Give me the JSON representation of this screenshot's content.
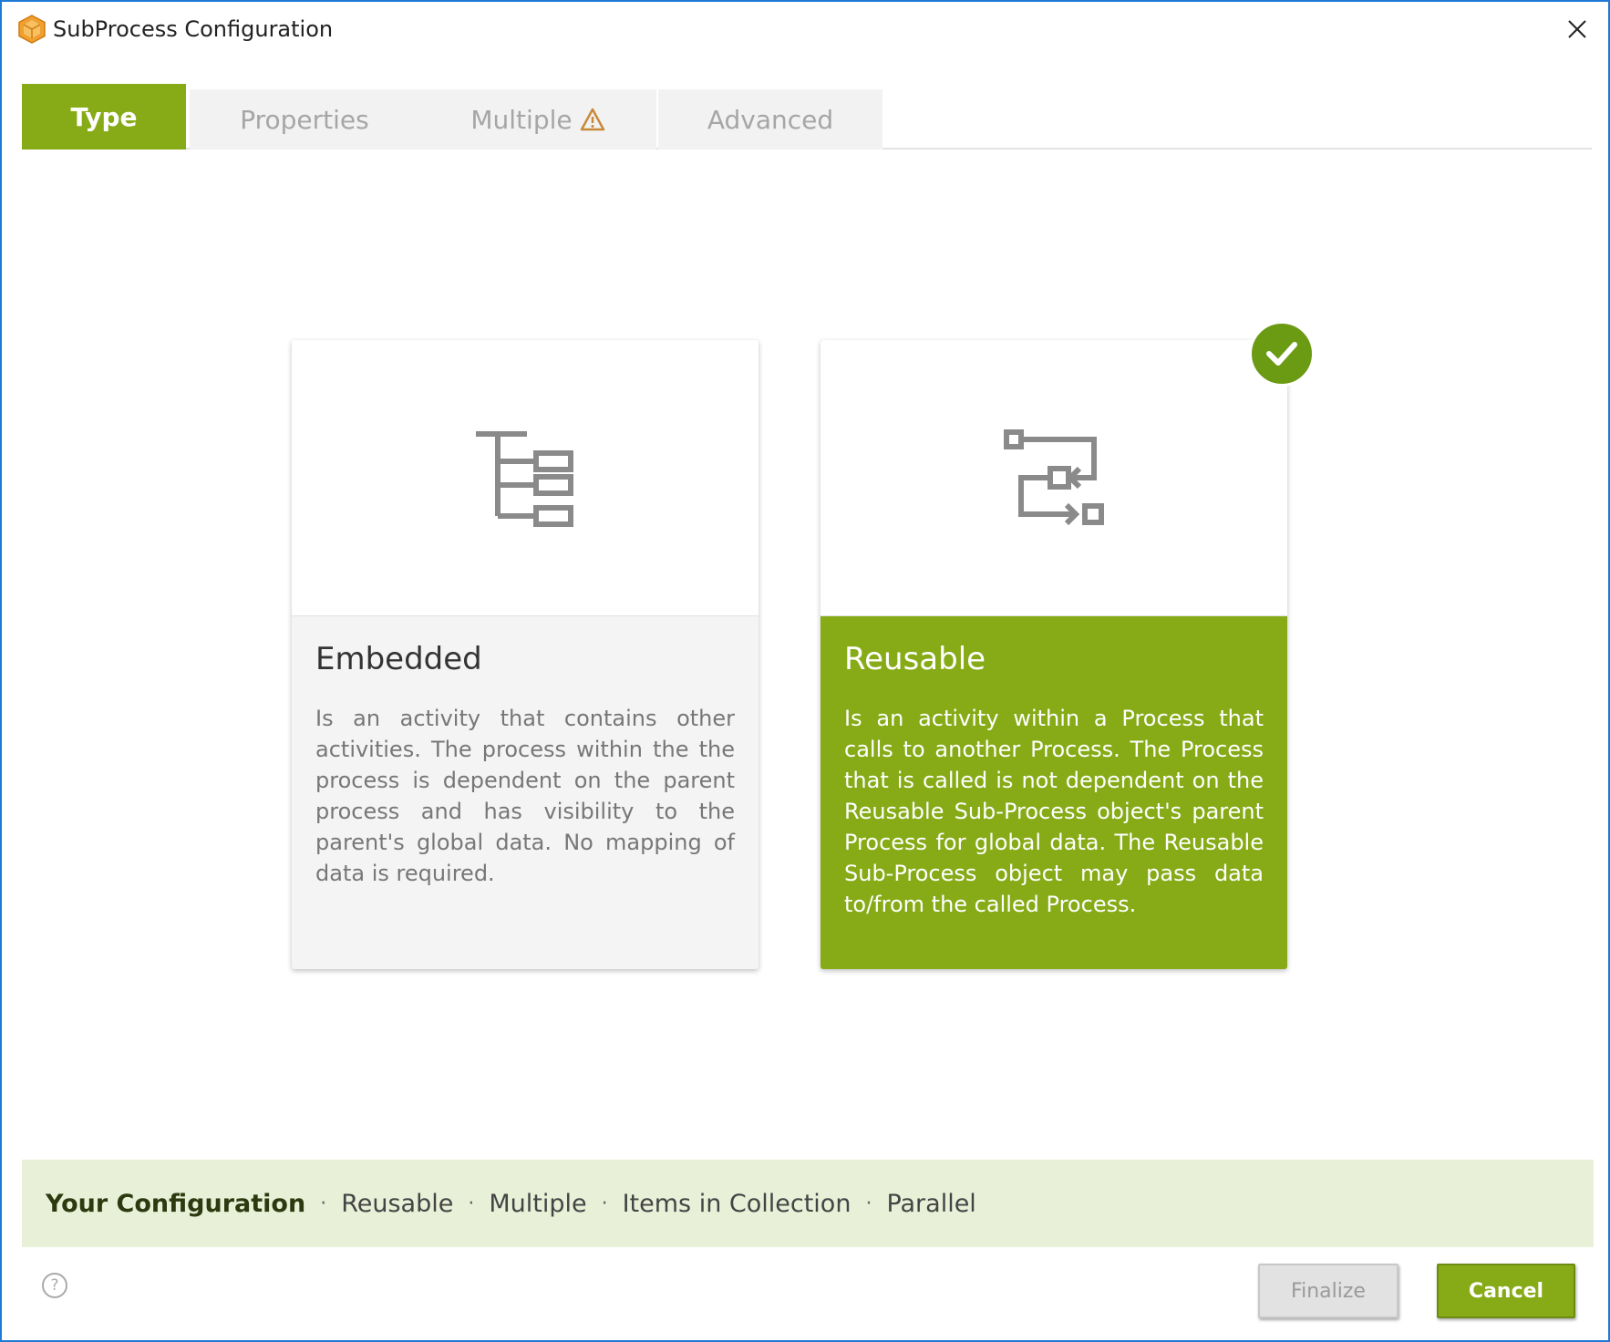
{
  "window": {
    "title": "SubProcess Configuration",
    "icon": "cube-icon"
  },
  "tabs": [
    {
      "label": "Type",
      "active": true
    },
    {
      "label": "Properties",
      "active": false
    },
    {
      "label": "Multiple",
      "active": false,
      "icon": "warning-icon"
    },
    {
      "label": "Advanced",
      "active": false
    }
  ],
  "cards": [
    {
      "title": "Embedded",
      "icon": "tree-hierarchy-icon",
      "selected": false,
      "description": "Is an activity that contains other activities. The process within the the process is dependent on the parent process and has visibility to the parent's global data. No mapping of data is required."
    },
    {
      "title": "Reusable",
      "icon": "process-flow-icon",
      "selected": true,
      "description": "Is an activity within a Process that calls to another Process. The Process that is called is not dependent on the Reusable Sub-Process object's parent Process for global data. The Reusable Sub-Process object may pass data to/from the called Process."
    }
  ],
  "configuration": {
    "label": "Your Configuration",
    "separator": "·",
    "items": [
      "Reusable",
      "Multiple",
      "Items in Collection",
      "Parallel"
    ]
  },
  "footer": {
    "help": "?",
    "finalize_label": "Finalize",
    "cancel_label": "Cancel"
  },
  "colors": {
    "accent": "#86ab17",
    "config_bar_bg": "#e8f0d8",
    "window_border": "#1f7ad6",
    "warning": "#c8893a"
  }
}
